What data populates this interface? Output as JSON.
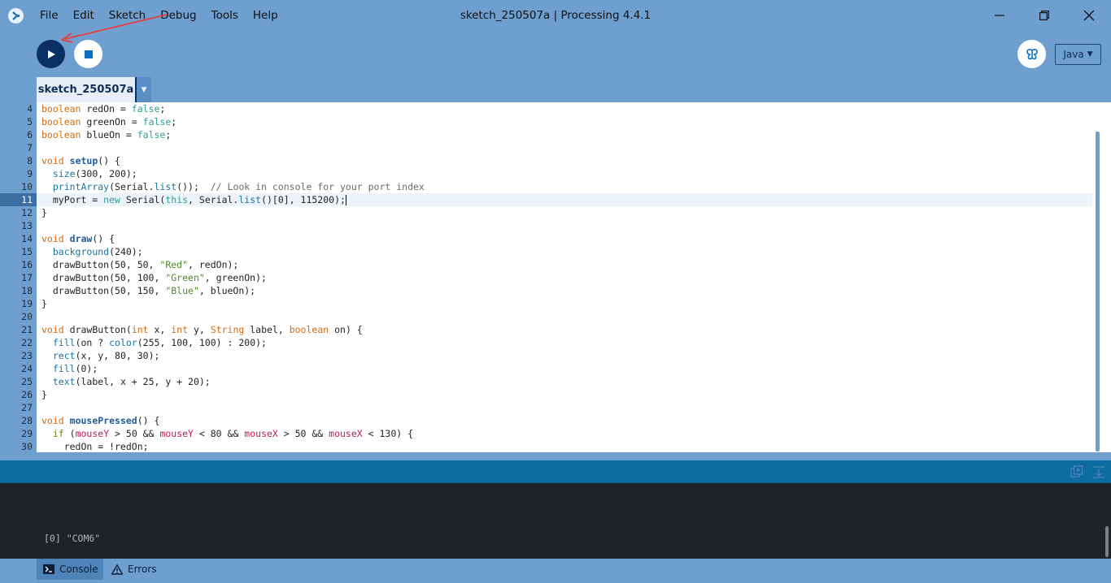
{
  "window": {
    "title": "sketch_250507a | Processing 4.4.1"
  },
  "menu": {
    "items": [
      "File",
      "Edit",
      "Sketch",
      "Debug",
      "Tools",
      "Help"
    ]
  },
  "toolbar": {
    "run_icon": "play-icon",
    "stop_icon": "stop-icon",
    "debugger_icon": "butterfly-icon",
    "mode_label": "Java"
  },
  "tabs": {
    "sketch_tab_label": "sketch_250507a"
  },
  "editor": {
    "current_line": 11,
    "lines": [
      {
        "n": "4",
        "tokens": [
          [
            "kw",
            "boolean"
          ],
          [
            "plain",
            " redOn = "
          ],
          [
            "lit",
            "false"
          ],
          [
            "plain",
            ";"
          ]
        ]
      },
      {
        "n": "5",
        "tokens": [
          [
            "kw",
            "boolean"
          ],
          [
            "plain",
            " greenOn = "
          ],
          [
            "lit",
            "false"
          ],
          [
            "plain",
            ";"
          ]
        ]
      },
      {
        "n": "6",
        "tokens": [
          [
            "kw",
            "boolean"
          ],
          [
            "plain",
            " blueOn = "
          ],
          [
            "lit",
            "false"
          ],
          [
            "plain",
            ";"
          ]
        ]
      },
      {
        "n": "7",
        "tokens": []
      },
      {
        "n": "8",
        "tokens": [
          [
            "kw",
            "void"
          ],
          [
            "plain",
            " "
          ],
          [
            "fn",
            "setup"
          ],
          [
            "plain",
            "() {"
          ]
        ]
      },
      {
        "n": "9",
        "tokens": [
          [
            "plain",
            "  "
          ],
          [
            "call",
            "size"
          ],
          [
            "plain",
            "(300, 200);"
          ]
        ]
      },
      {
        "n": "10",
        "tokens": [
          [
            "plain",
            "  "
          ],
          [
            "call",
            "printArray"
          ],
          [
            "plain",
            "(Serial."
          ],
          [
            "call",
            "list"
          ],
          [
            "plain",
            "());  "
          ],
          [
            "com",
            "// Look in console for your port index"
          ]
        ]
      },
      {
        "n": "11",
        "tokens": [
          [
            "plain",
            "  myPort = "
          ],
          [
            "lit",
            "new"
          ],
          [
            "plain",
            " Serial("
          ],
          [
            "lit",
            "this"
          ],
          [
            "plain",
            ", Serial."
          ],
          [
            "call",
            "list"
          ],
          [
            "plain",
            "()[0], 115200);"
          ]
        ]
      },
      {
        "n": "12",
        "tokens": [
          [
            "plain",
            "}"
          ]
        ]
      },
      {
        "n": "13",
        "tokens": []
      },
      {
        "n": "14",
        "tokens": [
          [
            "kw",
            "void"
          ],
          [
            "plain",
            " "
          ],
          [
            "fn",
            "draw"
          ],
          [
            "plain",
            "() {"
          ]
        ]
      },
      {
        "n": "15",
        "tokens": [
          [
            "plain",
            "  "
          ],
          [
            "call",
            "background"
          ],
          [
            "plain",
            "(240);"
          ]
        ]
      },
      {
        "n": "16",
        "tokens": [
          [
            "plain",
            "  drawButton(50, 50, "
          ],
          [
            "str",
            "\"Red\""
          ],
          [
            "plain",
            ", redOn);"
          ]
        ]
      },
      {
        "n": "17",
        "tokens": [
          [
            "plain",
            "  drawButton(50, 100, "
          ],
          [
            "str",
            "\"Green\""
          ],
          [
            "plain",
            ", greenOn);"
          ]
        ]
      },
      {
        "n": "18",
        "tokens": [
          [
            "plain",
            "  drawButton(50, 150, "
          ],
          [
            "str",
            "\"Blue\""
          ],
          [
            "plain",
            ", blueOn);"
          ]
        ]
      },
      {
        "n": "19",
        "tokens": [
          [
            "plain",
            "}"
          ]
        ]
      },
      {
        "n": "20",
        "tokens": []
      },
      {
        "n": "21",
        "tokens": [
          [
            "kw",
            "void"
          ],
          [
            "plain",
            " drawButton("
          ],
          [
            "kw",
            "int"
          ],
          [
            "plain",
            " x, "
          ],
          [
            "kw",
            "int"
          ],
          [
            "plain",
            " y, "
          ],
          [
            "kw",
            "String"
          ],
          [
            "plain",
            " label, "
          ],
          [
            "kw",
            "boolean"
          ],
          [
            "plain",
            " on) {"
          ]
        ]
      },
      {
        "n": "22",
        "tokens": [
          [
            "plain",
            "  "
          ],
          [
            "call",
            "fill"
          ],
          [
            "plain",
            "(on ? "
          ],
          [
            "call",
            "color"
          ],
          [
            "plain",
            "(255, 100, 100) : 200);"
          ]
        ]
      },
      {
        "n": "23",
        "tokens": [
          [
            "plain",
            "  "
          ],
          [
            "call",
            "rect"
          ],
          [
            "plain",
            "(x, y, 80, 30);"
          ]
        ]
      },
      {
        "n": "24",
        "tokens": [
          [
            "plain",
            "  "
          ],
          [
            "call",
            "fill"
          ],
          [
            "plain",
            "(0);"
          ]
        ]
      },
      {
        "n": "25",
        "tokens": [
          [
            "plain",
            "  "
          ],
          [
            "call",
            "text"
          ],
          [
            "plain",
            "(label, x + 25, y + 20);"
          ]
        ]
      },
      {
        "n": "26",
        "tokens": [
          [
            "plain",
            "}"
          ]
        ]
      },
      {
        "n": "27",
        "tokens": []
      },
      {
        "n": "28",
        "tokens": [
          [
            "kw",
            "void"
          ],
          [
            "plain",
            " "
          ],
          [
            "fn",
            "mousePressed"
          ],
          [
            "plain",
            "() {"
          ]
        ]
      },
      {
        "n": "29",
        "tokens": [
          [
            "plain",
            "  "
          ],
          [
            "ctl",
            "if"
          ],
          [
            "plain",
            " ("
          ],
          [
            "var",
            "mouseY"
          ],
          [
            "plain",
            " > 50 && "
          ],
          [
            "var",
            "mouseY"
          ],
          [
            "plain",
            " < 80 && "
          ],
          [
            "var",
            "mouseX"
          ],
          [
            "plain",
            " > 50 && "
          ],
          [
            "var",
            "mouseX"
          ],
          [
            "plain",
            " < 130) {"
          ]
        ]
      },
      {
        "n": "30",
        "tokens": [
          [
            "plain",
            "    redOn = !redOn;"
          ]
        ]
      }
    ]
  },
  "console": {
    "output": "[0] \"COM6\"",
    "copy_icon": "copy-icon",
    "clear_icon": "clear-console-icon"
  },
  "footer": {
    "console_tab_label": "Console",
    "errors_tab_label": "Errors"
  }
}
